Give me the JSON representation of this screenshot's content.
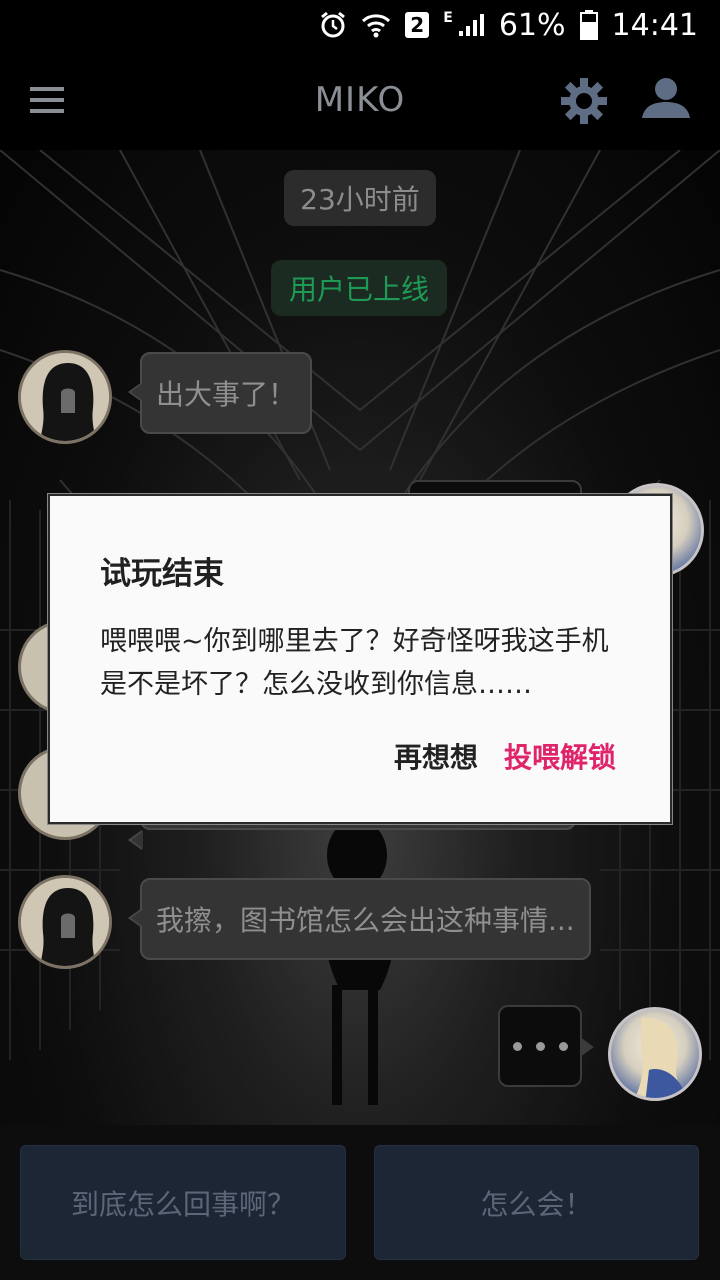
{
  "status_bar": {
    "sim_label": "2",
    "network_type": "E",
    "battery_percent": "61%",
    "time": "14:41",
    "icons": [
      "alarm-icon",
      "wifi-icon",
      "sim-icon",
      "signal-icon",
      "battery-icon"
    ]
  },
  "app_bar": {
    "title": "MIKO",
    "icons": [
      "menu-icon",
      "gear-icon",
      "user-icon"
    ]
  },
  "chat": {
    "time_label": "23小时前",
    "online_label": "用户已上线",
    "messages": [
      {
        "side": "left",
        "text": "出大事了！"
      },
      {
        "side": "left",
        "text": "我擦，图书馆怎么会出这种事情..."
      },
      {
        "side": "right",
        "typing": true
      }
    ]
  },
  "dialog": {
    "title": "试玩结束",
    "message": "喂喂喂~你到哪里去了？好奇怪呀我这手机是不是坏了？怎么没收到你信息……",
    "negative_button": "再想想",
    "positive_button": "投喂解锁"
  },
  "reply_options": [
    "到底怎么回事啊？",
    "怎么会！"
  ],
  "colors": {
    "accent_pink": "#e0246a",
    "online_green": "#1e9a56",
    "reply_button_bg": "#1d2634"
  }
}
